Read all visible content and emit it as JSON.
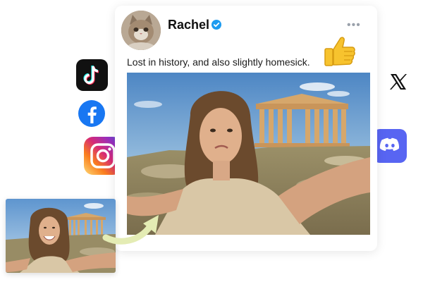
{
  "post": {
    "user": {
      "name": "Rachel",
      "verified": true
    },
    "caption": "Lost in history, and also slightly homesick.",
    "more_label": "•••",
    "reaction": "thumbs-up-icon"
  },
  "social_icons": [
    "tiktok-icon",
    "facebook-icon",
    "instagram-icon",
    "x-icon",
    "discord-icon"
  ],
  "colors": {
    "verified": "#1d9bf0",
    "facebook": "#1877f2",
    "discord": "#5865f2",
    "tiktok": "#111111",
    "x": "#111111",
    "arrow": "#e4ecb4",
    "sky": "#6aa2cf",
    "stone": "#c99e68"
  }
}
